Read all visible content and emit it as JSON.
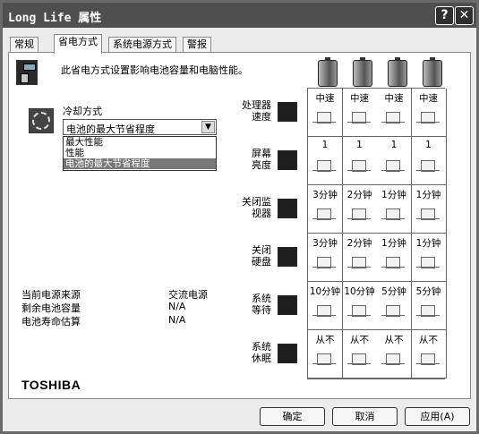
{
  "window": {
    "title": "Long Life 属性",
    "help_glyph": "?",
    "close_glyph": "✕"
  },
  "tabs": [
    {
      "label": "常规"
    },
    {
      "label": "省电方式"
    },
    {
      "label": "系统电源方式"
    },
    {
      "label": "警报"
    }
  ],
  "intro_text": "此省电方式设置影响电池容量和电脑性能。",
  "cooling": {
    "label": "冷却方式",
    "selected": "电池的最大节省程度",
    "options": [
      "最大性能",
      "性能",
      "电池的最大节省程度"
    ]
  },
  "status": {
    "rows": [
      {
        "label": "当前电源来源",
        "value": "交流电源"
      },
      {
        "label": "剩余电池容量",
        "value": "N/A"
      },
      {
        "label": "电池寿命估算",
        "value": "N/A"
      }
    ]
  },
  "brand": "TOSHIBA",
  "grid": {
    "rows": [
      {
        "label_line1": "处理器",
        "label_line2": "速度",
        "icon": "cpu-icon",
        "values": [
          "中速",
          "中速",
          "中速",
          "中速"
        ]
      },
      {
        "label_line1": "屏幕",
        "label_line2": "亮度",
        "icon": "brightness-icon",
        "values": [
          "1",
          "1",
          "1",
          "1"
        ]
      },
      {
        "label_line1": "关闭监",
        "label_line2": "视器",
        "icon": "monitor-icon",
        "values": [
          "3分钟",
          "2分钟",
          "1分钟",
          "1分钟"
        ]
      },
      {
        "label_line1": "关闭",
        "label_line2": "硬盘",
        "icon": "harddisk-icon",
        "values": [
          "3分钟",
          "2分钟",
          "1分钟",
          "1分钟"
        ]
      },
      {
        "label_line1": "系统",
        "label_line2": "等待",
        "icon": "standby-icon",
        "values": [
          "10分钟",
          "10分钟",
          "5分钟",
          "5分钟"
        ]
      },
      {
        "label_line1": "系统",
        "label_line2": "休眠",
        "icon": "hibernate-icon",
        "values": [
          "从不",
          "从不",
          "从不",
          "从不"
        ]
      }
    ]
  },
  "buttons": {
    "ok": "确定",
    "cancel": "取消",
    "apply": "应用(A)"
  }
}
